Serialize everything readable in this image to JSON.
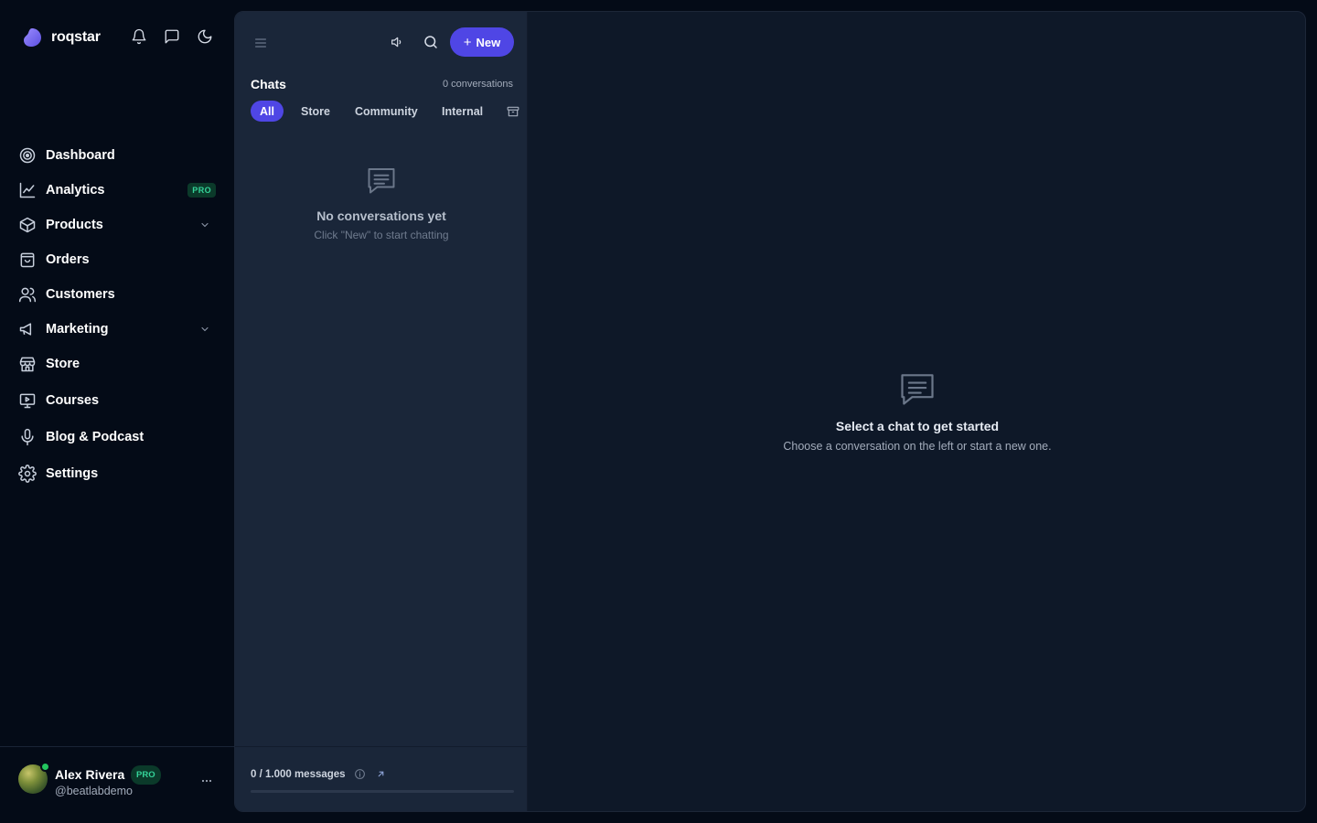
{
  "brand": {
    "name": "roqstar",
    "logo_color": "#7c6cf0"
  },
  "header_icons": [
    "bell-icon",
    "message-square-icon",
    "moon-icon"
  ],
  "nav": {
    "items": [
      {
        "label": "Dashboard",
        "icon": "target-icon"
      },
      {
        "label": "Analytics",
        "icon": "chart-line-icon",
        "badge": "PRO"
      },
      {
        "label": "Products",
        "icon": "box-icon",
        "expandable": true
      },
      {
        "label": "Orders",
        "icon": "shopping-bag-icon"
      },
      {
        "label": "Customers",
        "icon": "users-icon"
      },
      {
        "label": "Marketing",
        "icon": "megaphone-icon",
        "expandable": true
      },
      {
        "label": "Store",
        "icon": "storefront-icon"
      },
      {
        "label": "Courses",
        "icon": "presentation-icon"
      },
      {
        "label": "Blog & Podcast",
        "icon": "microphone-icon"
      },
      {
        "label": "Settings",
        "icon": "gear-icon"
      }
    ]
  },
  "user": {
    "name": "Alex Rivera",
    "badge": "PRO",
    "handle": "@beatlabdemo",
    "status": "online"
  },
  "chats": {
    "title": "Chats",
    "count_label": "0 conversations",
    "new_button": "New",
    "tabs": [
      "All",
      "Store",
      "Community",
      "Internal"
    ],
    "active_tab": "All",
    "empty_title": "No conversations yet",
    "empty_subtitle": "Click \"New\" to start chatting"
  },
  "quota": {
    "label": "0 / 1.000 messages",
    "used": 0,
    "limit": 1000
  },
  "main_empty": {
    "title": "Select a chat to get started",
    "subtitle": "Choose a conversation on the left or start a new one."
  },
  "colors": {
    "accent": "#4f46e5",
    "pro_badge": "#34d399",
    "online": "#22c55e",
    "background": "#040b17",
    "panel": "#1a2639"
  }
}
